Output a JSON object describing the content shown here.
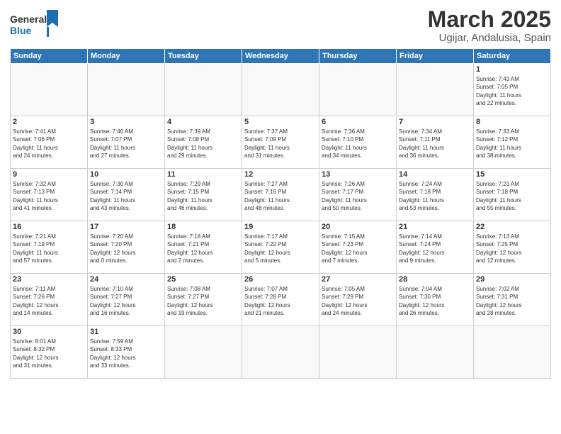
{
  "header": {
    "logo_general": "General",
    "logo_blue": "Blue",
    "month_title": "March 2025",
    "location": "Ugijar, Andalusia, Spain"
  },
  "weekdays": [
    "Sunday",
    "Monday",
    "Tuesday",
    "Wednesday",
    "Thursday",
    "Friday",
    "Saturday"
  ],
  "weeks": [
    [
      {
        "day": "",
        "info": ""
      },
      {
        "day": "",
        "info": ""
      },
      {
        "day": "",
        "info": ""
      },
      {
        "day": "",
        "info": ""
      },
      {
        "day": "",
        "info": ""
      },
      {
        "day": "",
        "info": ""
      },
      {
        "day": "1",
        "info": "Sunrise: 7:43 AM\nSunset: 7:05 PM\nDaylight: 11 hours\nand 22 minutes."
      }
    ],
    [
      {
        "day": "2",
        "info": "Sunrise: 7:41 AM\nSunset: 7:06 PM\nDaylight: 11 hours\nand 24 minutes."
      },
      {
        "day": "3",
        "info": "Sunrise: 7:40 AM\nSunset: 7:07 PM\nDaylight: 11 hours\nand 27 minutes."
      },
      {
        "day": "4",
        "info": "Sunrise: 7:39 AM\nSunset: 7:08 PM\nDaylight: 11 hours\nand 29 minutes."
      },
      {
        "day": "5",
        "info": "Sunrise: 7:37 AM\nSunset: 7:09 PM\nDaylight: 11 hours\nand 31 minutes."
      },
      {
        "day": "6",
        "info": "Sunrise: 7:36 AM\nSunset: 7:10 PM\nDaylight: 11 hours\nand 34 minutes."
      },
      {
        "day": "7",
        "info": "Sunrise: 7:34 AM\nSunset: 7:11 PM\nDaylight: 11 hours\nand 36 minutes."
      },
      {
        "day": "8",
        "info": "Sunrise: 7:33 AM\nSunset: 7:12 PM\nDaylight: 11 hours\nand 38 minutes."
      }
    ],
    [
      {
        "day": "9",
        "info": "Sunrise: 7:32 AM\nSunset: 7:13 PM\nDaylight: 11 hours\nand 41 minutes."
      },
      {
        "day": "10",
        "info": "Sunrise: 7:30 AM\nSunset: 7:14 PM\nDaylight: 11 hours\nand 43 minutes."
      },
      {
        "day": "11",
        "info": "Sunrise: 7:29 AM\nSunset: 7:15 PM\nDaylight: 11 hours\nand 46 minutes."
      },
      {
        "day": "12",
        "info": "Sunrise: 7:27 AM\nSunset: 7:16 PM\nDaylight: 11 hours\nand 48 minutes."
      },
      {
        "day": "13",
        "info": "Sunrise: 7:26 AM\nSunset: 7:17 PM\nDaylight: 11 hours\nand 50 minutes."
      },
      {
        "day": "14",
        "info": "Sunrise: 7:24 AM\nSunset: 7:18 PM\nDaylight: 11 hours\nand 53 minutes."
      },
      {
        "day": "15",
        "info": "Sunrise: 7:23 AM\nSunset: 7:18 PM\nDaylight: 11 hours\nand 55 minutes."
      }
    ],
    [
      {
        "day": "16",
        "info": "Sunrise: 7:21 AM\nSunset: 7:19 PM\nDaylight: 11 hours\nand 57 minutes."
      },
      {
        "day": "17",
        "info": "Sunrise: 7:20 AM\nSunset: 7:20 PM\nDaylight: 12 hours\nand 0 minutes."
      },
      {
        "day": "18",
        "info": "Sunrise: 7:18 AM\nSunset: 7:21 PM\nDaylight: 12 hours\nand 2 minutes."
      },
      {
        "day": "19",
        "info": "Sunrise: 7:17 AM\nSunset: 7:22 PM\nDaylight: 12 hours\nand 5 minutes."
      },
      {
        "day": "20",
        "info": "Sunrise: 7:15 AM\nSunset: 7:23 PM\nDaylight: 12 hours\nand 7 minutes."
      },
      {
        "day": "21",
        "info": "Sunrise: 7:14 AM\nSunset: 7:24 PM\nDaylight: 12 hours\nand 9 minutes."
      },
      {
        "day": "22",
        "info": "Sunrise: 7:13 AM\nSunset: 7:25 PM\nDaylight: 12 hours\nand 12 minutes."
      }
    ],
    [
      {
        "day": "23",
        "info": "Sunrise: 7:11 AM\nSunset: 7:26 PM\nDaylight: 12 hours\nand 14 minutes."
      },
      {
        "day": "24",
        "info": "Sunrise: 7:10 AM\nSunset: 7:27 PM\nDaylight: 12 hours\nand 16 minutes."
      },
      {
        "day": "25",
        "info": "Sunrise: 7:08 AM\nSunset: 7:27 PM\nDaylight: 12 hours\nand 19 minutes."
      },
      {
        "day": "26",
        "info": "Sunrise: 7:07 AM\nSunset: 7:28 PM\nDaylight: 12 hours\nand 21 minutes."
      },
      {
        "day": "27",
        "info": "Sunrise: 7:05 AM\nSunset: 7:29 PM\nDaylight: 12 hours\nand 24 minutes."
      },
      {
        "day": "28",
        "info": "Sunrise: 7:04 AM\nSunset: 7:30 PM\nDaylight: 12 hours\nand 26 minutes."
      },
      {
        "day": "29",
        "info": "Sunrise: 7:02 AM\nSunset: 7:31 PM\nDaylight: 12 hours\nand 28 minutes."
      }
    ],
    [
      {
        "day": "30",
        "info": "Sunrise: 8:01 AM\nSunset: 8:32 PM\nDaylight: 12 hours\nand 31 minutes."
      },
      {
        "day": "31",
        "info": "Sunrise: 7:59 AM\nSunset: 8:33 PM\nDaylight: 12 hours\nand 33 minutes."
      },
      {
        "day": "",
        "info": ""
      },
      {
        "day": "",
        "info": ""
      },
      {
        "day": "",
        "info": ""
      },
      {
        "day": "",
        "info": ""
      },
      {
        "day": "",
        "info": ""
      }
    ]
  ]
}
